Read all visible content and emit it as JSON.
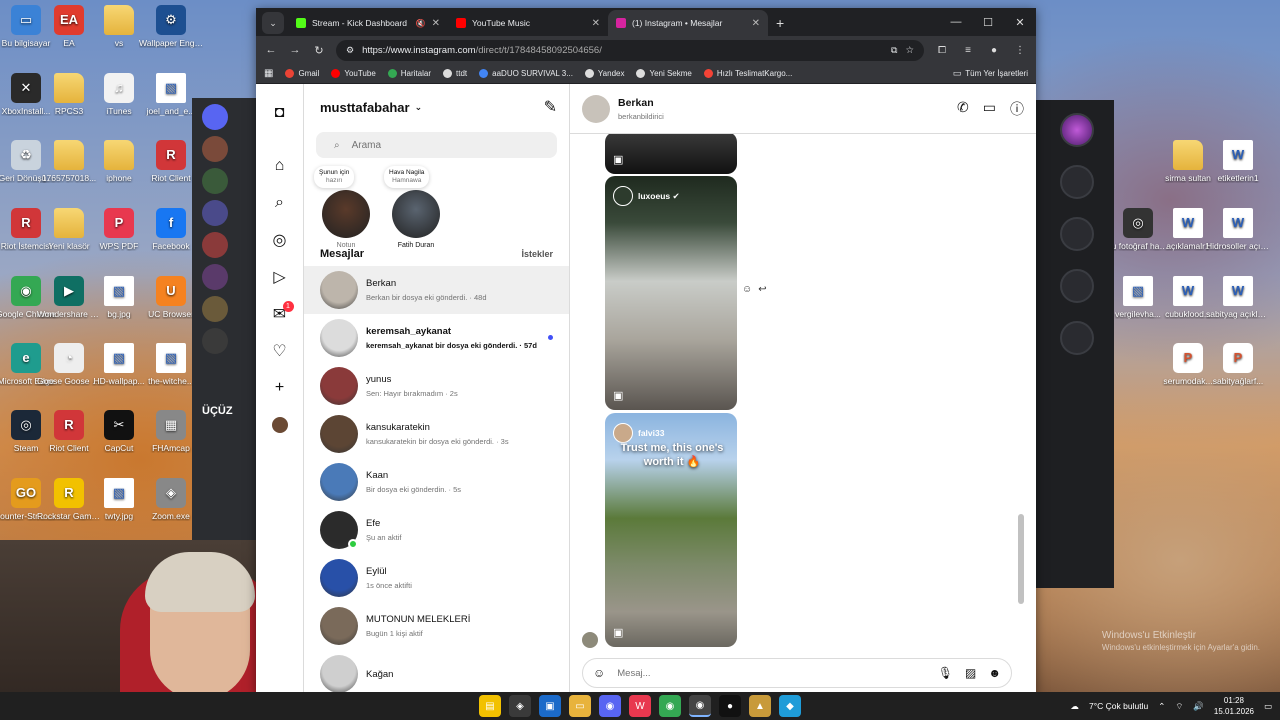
{
  "desktop": {
    "icons_left": [
      {
        "label": "Bu bilgisayar",
        "color": "#3b82d6",
        "glyph": "▭"
      },
      {
        "label": "EA",
        "color": "#e03b2e",
        "glyph": "EA"
      },
      {
        "label": "vs",
        "color": "folder",
        "glyph": ""
      },
      {
        "label": "Wallpaper Engine",
        "color": "#1d4f91",
        "glyph": "⚙"
      },
      {
        "label": "XboxInstall...",
        "color": "#2a2a2a",
        "glyph": "✕"
      },
      {
        "label": "RPCS3",
        "color": "folder",
        "glyph": ""
      },
      {
        "label": "iTunes",
        "color": "#f2f2f2",
        "glyph": "♫"
      },
      {
        "label": "joel_and_e...",
        "color": "doc",
        "glyph": "▧"
      },
      {
        "label": "Geri Dönüşü...",
        "color": "#c9d3dd",
        "glyph": "♻"
      },
      {
        "label": "1765757018...",
        "color": "folder",
        "glyph": ""
      },
      {
        "label": "iphone",
        "color": "folder",
        "glyph": ""
      },
      {
        "label": "Riot Client",
        "color": "#d13639",
        "glyph": "R"
      },
      {
        "label": "Riot İstemcisi",
        "color": "#d13639",
        "glyph": "R"
      },
      {
        "label": "Yeni klasör",
        "color": "folder",
        "glyph": ""
      },
      {
        "label": "WPS PDF",
        "color": "#e8384f",
        "glyph": "P"
      },
      {
        "label": "Facebook",
        "color": "#1877f2",
        "glyph": "f"
      },
      {
        "label": "Google Chrome",
        "color": "#34a853",
        "glyph": "◉"
      },
      {
        "label": "Wondershare Filmora 13",
        "color": "#0f6f63",
        "glyph": "▶"
      },
      {
        "label": "bg.jpg",
        "color": "doc",
        "glyph": "▧"
      },
      {
        "label": "UC Browser",
        "color": "#f58220",
        "glyph": "U"
      },
      {
        "label": "Microsoft Edge",
        "color": "#1f9c8e",
        "glyph": "e"
      },
      {
        "label": "Goose Goose Duck",
        "color": "#eee",
        "glyph": "◔"
      },
      {
        "label": "HD-wallpap...",
        "color": "doc",
        "glyph": "▧"
      },
      {
        "label": "the-witche...",
        "color": "doc",
        "glyph": "▧"
      },
      {
        "label": "Steam",
        "color": "#1b2838",
        "glyph": "◎"
      },
      {
        "label": "Riot Client",
        "color": "#d13639",
        "glyph": "R"
      },
      {
        "label": "CapCut",
        "color": "#111",
        "glyph": "✂"
      },
      {
        "label": "FHAmcap",
        "color": "#888",
        "glyph": "▦"
      },
      {
        "label": "Counter-Str... Global Offe...",
        "color": "#e49b1d",
        "glyph": "GO"
      },
      {
        "label": "Rockstar Games...",
        "color": "#f2c100",
        "glyph": "R"
      },
      {
        "label": "twty.jpg",
        "color": "doc",
        "glyph": "▧"
      },
      {
        "label": "Zoom.exe",
        "color": "#888",
        "glyph": "◈"
      }
    ],
    "icons_right": [
      {
        "label": "sirma sultan",
        "color": "folder",
        "glyph": ""
      },
      {
        "label": "etiketlerin1",
        "color": "doc",
        "glyph": "W"
      },
      {
        "label": "Bu fotoğraf hakkında ...",
        "color": "#333",
        "glyph": "◎"
      },
      {
        "label": "açıklamalr1",
        "color": "doc",
        "glyph": "W"
      },
      {
        "label": "Hidrosoller açıklamarl1",
        "color": "doc",
        "glyph": "W"
      },
      {
        "label": "vergilevha...",
        "color": "doc",
        "glyph": "▧"
      },
      {
        "label": "cubuklood...",
        "color": "doc",
        "glyph": "W"
      },
      {
        "label": "sabityag açıklamarl1",
        "color": "doc",
        "glyph": "W"
      },
      {
        "label": "serumodak...",
        "color": "ppt",
        "glyph": "P"
      },
      {
        "label": "sabityağlarf...",
        "color": "ppt",
        "glyph": "P"
      }
    ],
    "ucuz_label": "ÜÇÜZ",
    "yeni_badge": "YENİ",
    "activate_line1": "Windows'u Etkinleştir",
    "activate_line2": "Windows'u etkinleştirmek için Ayarlar'a gidin."
  },
  "browser": {
    "tabs": [
      {
        "title": "Stream - Kick Dashboard",
        "fav": "#53fc18",
        "muted": true
      },
      {
        "title": "YouTube Music",
        "fav": "#ff0000",
        "muted": false
      },
      {
        "title": "(1) Instagram • Mesajlar",
        "fav": "#d6249f",
        "muted": false
      }
    ],
    "url_host": "https://www.instagram.com",
    "url_path": "/direct/t/17848458092504656/",
    "bookmarks": [
      {
        "label": "Gmail",
        "color": "#ea4335"
      },
      {
        "label": "YouTube",
        "color": "#ff0000"
      },
      {
        "label": "Haritalar",
        "color": "#34a853"
      },
      {
        "label": "ttdt",
        "color": "#ddd"
      },
      {
        "label": "aaDUO SURVIVAL 3...",
        "color": "#4285f4"
      },
      {
        "label": "Yandex",
        "color": "#ddd"
      },
      {
        "label": "Yeni Sekme",
        "color": "#ddd"
      },
      {
        "label": "Hızlı TeslimatKargo...",
        "color": "#f44336"
      }
    ],
    "all_bookmarks": "Tüm Yer İşaretleri"
  },
  "instagram": {
    "rail_badge": "1",
    "username": "musttafabahar",
    "search_placeholder": "Arama",
    "notes": [
      {
        "bubble_l1": "Şunun için",
        "bubble_l2": "hazırı",
        "label": "Notun",
        "color": "#5a3a2a"
      },
      {
        "bubble_l1": "Hava Nagila",
        "bubble_l2": "Hamnawa",
        "label": "Fatih Duran",
        "color": "#5a6470"
      }
    ],
    "section_title": "Mesajlar",
    "requests": "İstekler",
    "conversations": [
      {
        "name": "Berkan",
        "msg": "Berkan bir dosya eki gönderdi.",
        "time": "48d",
        "color": "#bdb5ab",
        "selected": true,
        "unread": false,
        "online": false
      },
      {
        "name": "keremsah_aykanat",
        "msg": "keremsah_aykanat bir dosya eki gönderdi.",
        "time": "57d",
        "color": "#dcdcdc",
        "selected": false,
        "unread": true,
        "online": false
      },
      {
        "name": "yunus",
        "msg": "Sen: Hayır bırakmadım",
        "time": "2s",
        "color": "#8a3a3a",
        "selected": false,
        "unread": false,
        "online": false
      },
      {
        "name": "kansukaratekin",
        "msg": "kansukaratekin bir dosya eki gönderdi.",
        "time": "3s",
        "color": "#5c4534",
        "selected": false,
        "unread": false,
        "online": false
      },
      {
        "name": "Kaan",
        "msg": "Bir dosya eki gönderdin.",
        "time": "5s",
        "color": "#4a7ab8",
        "selected": false,
        "unread": false,
        "online": false
      },
      {
        "name": "Efe",
        "msg": "Şu an aktif",
        "time": "",
        "color": "#2b2b2b",
        "selected": false,
        "unread": false,
        "online": true
      },
      {
        "name": "Eylül",
        "msg": "1s önce aktifti",
        "time": "",
        "color": "#2850a8",
        "selected": false,
        "unread": false,
        "online": false
      },
      {
        "name": "MUTONUN MELEKLERİ",
        "msg": "Bugün 1 kişi aktif",
        "time": "",
        "color": "#7a6a5a",
        "selected": false,
        "unread": false,
        "online": false
      },
      {
        "name": "Kağan",
        "msg": "",
        "time": "",
        "color": "#cfcfcf",
        "selected": false,
        "unread": false,
        "online": false
      }
    ],
    "chat": {
      "name": "Berkan",
      "user": "berkanbildirici",
      "reels": [
        {
          "owner": "",
          "caption": "",
          "bg": "linear-gradient(180deg,#3a3a3a,#111)"
        },
        {
          "owner": "luxoeus ✔",
          "caption": "",
          "bg": "linear-gradient(180deg,#1f2a1f 0%,#3a4a3a 20%,#c9ccc8 45%,#a9a59c 70%,#5a5550 100%)"
        },
        {
          "owner": "falvi33",
          "caption": "Trust me, this one's worth it 🔥",
          "bg": "linear-gradient(180deg,#8bb4df 0%,#b8d2ec 20%,#5b7a3a 45%,#7d8a6a 65%,#9a958a 85%,#6b6860 100%)"
        }
      ],
      "compose_placeholder": "Mesaj..."
    }
  },
  "taskbar": {
    "weather": "7°C  Çok bulutlu",
    "time": "01:28",
    "date": "15.01.2026"
  }
}
